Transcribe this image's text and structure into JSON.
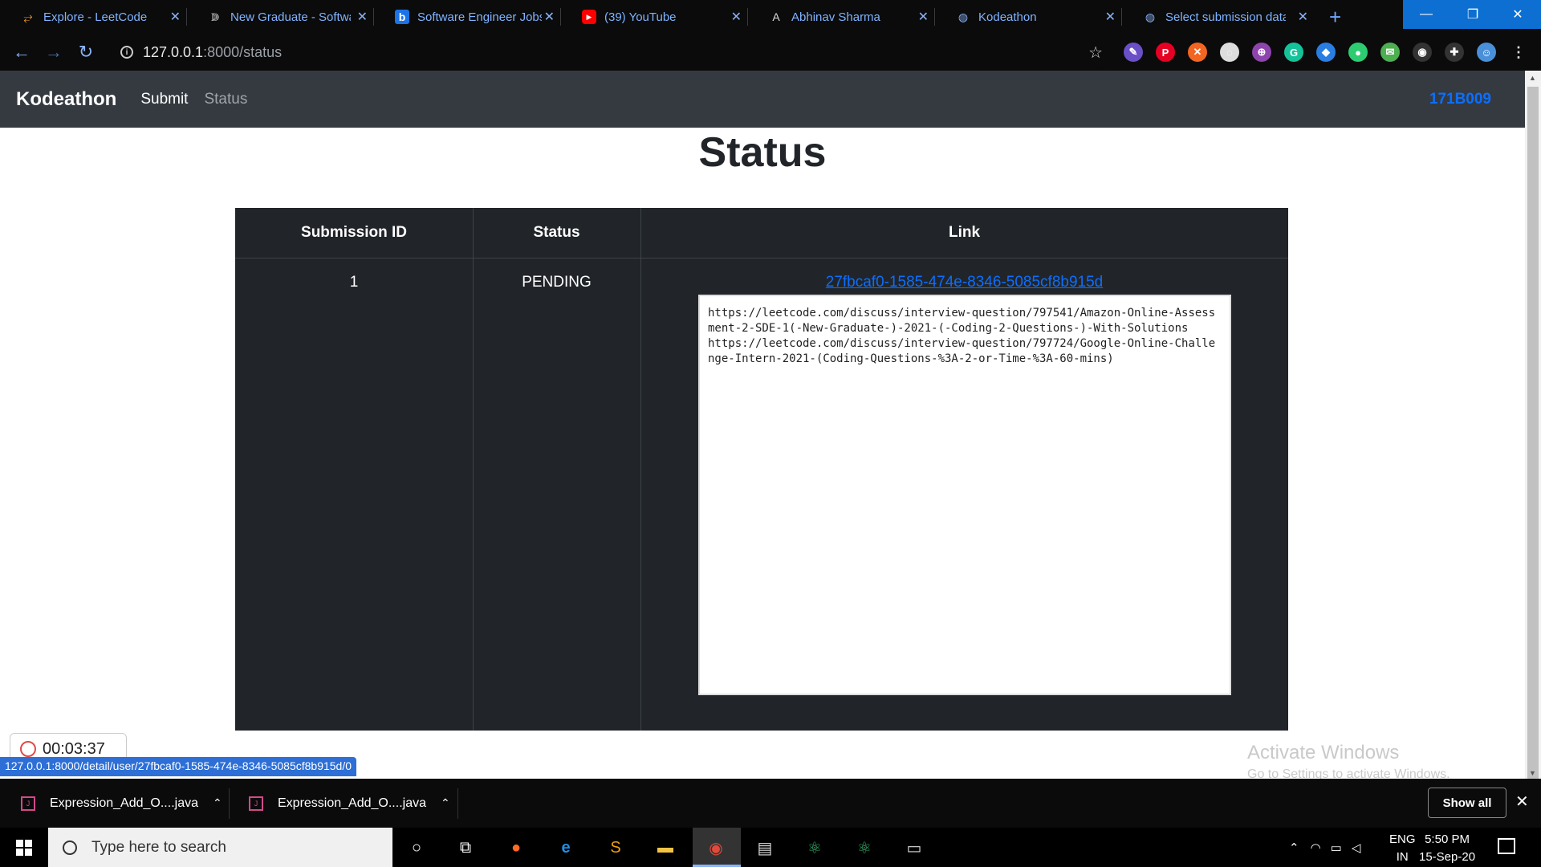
{
  "browser": {
    "tabs": [
      {
        "label": "Explore - LeetCode",
        "icon": "leetcode-icon",
        "glyph": "⥂"
      },
      {
        "label": "New Graduate - Software",
        "icon": "headphones-icon",
        "glyph": "ↇ"
      },
      {
        "label": "Software Engineer Jobs",
        "icon": "b-icon",
        "glyph": "b"
      },
      {
        "label": "(39) YouTube",
        "icon": "youtube-icon",
        "glyph": "▶"
      },
      {
        "label": "Abhinav Sharma",
        "icon": "a-icon",
        "glyph": "A"
      },
      {
        "label": "Kodeathon",
        "icon": "globe-icon",
        "glyph": "◍"
      },
      {
        "label": "Select submission data",
        "icon": "globe-icon",
        "glyph": "◍"
      }
    ],
    "url_host": "127.0.0.1",
    "url_path": ":8000/status",
    "status_url": "127.0.0.1:8000/detail/user/27fbcaf0-1585-474e-8346-5085cf8b915d/0",
    "extensions": [
      {
        "name": "feather-extension-icon",
        "color": "#6a4fc7",
        "glyph": "✎"
      },
      {
        "name": "pinterest-extension-icon",
        "color": "#e60023",
        "glyph": "P"
      },
      {
        "name": "orange-extension-icon",
        "color": "#f26522",
        "glyph": "✕"
      },
      {
        "name": "white-extension-icon",
        "color": "#dddddd",
        "glyph": "◌"
      },
      {
        "name": "purple-extension-icon",
        "color": "#8e44ad",
        "glyph": "⊕"
      },
      {
        "name": "grammarly-extension-icon",
        "color": "#15c39a",
        "glyph": "G"
      },
      {
        "name": "blue-extension-icon",
        "color": "#2a7de1",
        "glyph": "◆"
      },
      {
        "name": "green-extension-icon",
        "color": "#2ecc71",
        "glyph": "●"
      },
      {
        "name": "mail-extension-icon",
        "color": "#4caf50",
        "glyph": "✉"
      },
      {
        "name": "record-extension-icon",
        "color": "#333333",
        "glyph": "◉"
      },
      {
        "name": "puzzle-extension-icon",
        "color": "#333333",
        "glyph": "✚"
      },
      {
        "name": "profile-avatar-icon",
        "color": "#4a90d9",
        "glyph": "☺"
      }
    ]
  },
  "page": {
    "brand": "Kodeathon",
    "nav_submit": "Submit",
    "nav_status": "Status",
    "user_id": "171B009",
    "heading": "Status",
    "table": {
      "headers": [
        "Submission ID",
        "Status",
        "Link"
      ],
      "rows": [
        {
          "id": "1",
          "status": "PENDING",
          "link_text": "27fbcaf0-1585-474e-8346-5085cf8b915d",
          "links_content": "https://leetcode.com/discuss/interview-question/797541/Amazon-Online-Assessment-2-SDE-1(-New-Graduate-)-2021-(-Coding-2-Questions-)-With-Solutions\nhttps://leetcode.com/discuss/interview-question/797724/Google-Online-Challenge-Intern-2021-(Coding-Questions-%3A-2-or-Time-%3A-60-mins)"
        }
      ]
    }
  },
  "timer": "00:03:37",
  "activate_windows": {
    "title": "Activate Windows",
    "subtitle": "Go to Settings to activate Windows."
  },
  "downloads": {
    "items": [
      "Expression_Add_O....java",
      "Expression_Add_O....java"
    ],
    "show_all": "Show all"
  },
  "taskbar": {
    "search_placeholder": "Type here to search",
    "lang_top": "ENG",
    "lang_bottom": "IN",
    "time": "5:50 PM",
    "date": "15-Sep-20"
  }
}
